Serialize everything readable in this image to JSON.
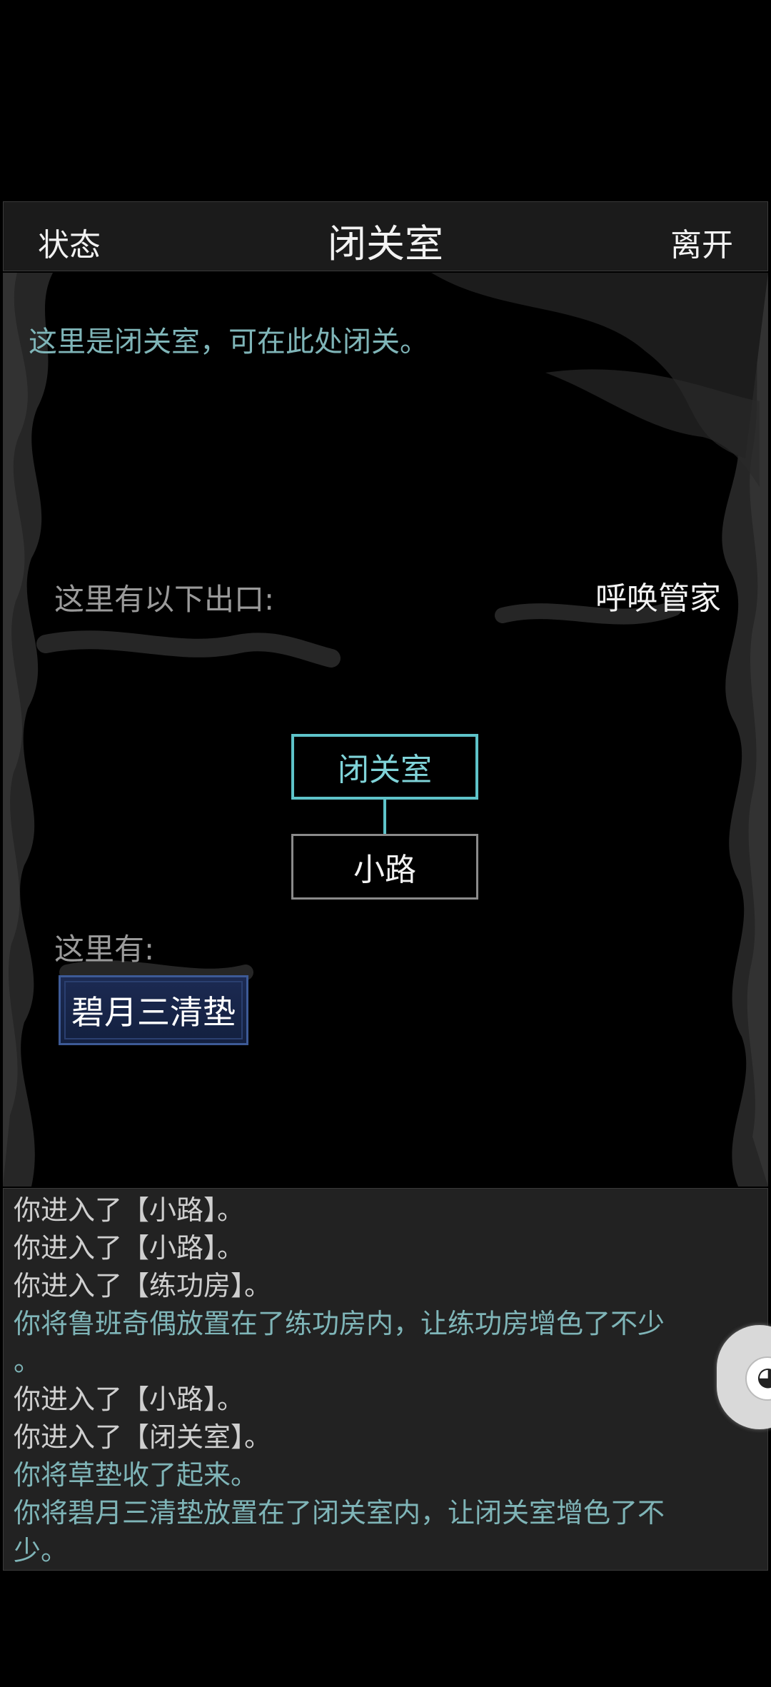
{
  "header": {
    "status_label": "状态",
    "title": "闭关室",
    "leave_label": "离开"
  },
  "scene": {
    "description": "这里是闭关室，可在此处闭关。",
    "exits_label": "这里有以下出口:",
    "summon_label": "呼唤管家",
    "map": {
      "current_room": "闭关室",
      "exit_room": "小路"
    },
    "here_label": "这里有:",
    "items": [
      "碧月三清垫"
    ]
  },
  "log": [
    {
      "text": "你进入了【小路】。",
      "color": "#cfcfcf"
    },
    {
      "text": "你进入了【小路】。",
      "color": "#cfcfcf"
    },
    {
      "text": "你进入了【练功房】。",
      "color": "#cfcfcf"
    },
    {
      "text": "你将鲁班奇偶放置在了练功房内，让练功房增色了不少",
      "color": "#7fb5b8"
    },
    {
      "text": "。",
      "color": "#7fb5b8"
    },
    {
      "text": "你进入了【小路】。",
      "color": "#cfcfcf"
    },
    {
      "text": "你进入了【闭关室】。",
      "color": "#cfcfcf"
    },
    {
      "text": "你将草垫收了起来。",
      "color": "#7fb5b8"
    },
    {
      "text": "你将碧月三清垫放置在了闭关室内，让闭关室增色了不",
      "color": "#7fb5b8"
    },
    {
      "text": "少。",
      "color": "#7fb5b8"
    }
  ],
  "floating_button": {
    "icon": "qq-penguin-icon"
  },
  "colors": {
    "accent_teal": "#5ec3c9",
    "log_teal": "#7fb5b8",
    "item_blue": "#1c2a52"
  }
}
